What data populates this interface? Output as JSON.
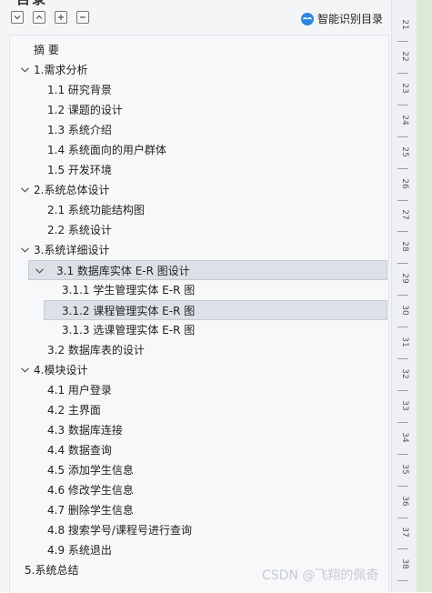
{
  "panel": {
    "title_cut": "目录",
    "smart_label": "智能识别目录",
    "toolbar_buttons": [
      "collapse-all",
      "expand-all",
      "add",
      "remove"
    ]
  },
  "toc": [
    {
      "label": "摘   要",
      "level": 0,
      "expand": "none"
    },
    {
      "label": "1.需求分析",
      "level": 0,
      "expand": "open"
    },
    {
      "label": "1.1  研究背景",
      "level": 1,
      "expand": "none"
    },
    {
      "label": "1.2  课题的设计",
      "level": 1,
      "expand": "none"
    },
    {
      "label": "1.3  系统介绍",
      "level": 1,
      "expand": "none"
    },
    {
      "label": "1.4  系统面向的用户群体",
      "level": 1,
      "expand": "none"
    },
    {
      "label": "1.5  开发环境",
      "level": 1,
      "expand": "none"
    },
    {
      "label": "2.系统总体设计",
      "level": 0,
      "expand": "open"
    },
    {
      "label": "2.1 系统功能结构图",
      "level": 1,
      "expand": "none"
    },
    {
      "label": "2.2 系统设计",
      "level": 1,
      "expand": "none"
    },
    {
      "label": "3.系统详细设计",
      "level": 0,
      "expand": "open"
    },
    {
      "label": "3.1 数据库实体 E-R 图设计",
      "level": 1,
      "expand": "open",
      "selected": true
    },
    {
      "label": "3.1.1 学生管理实体 E-R 图",
      "level": 2,
      "expand": "none"
    },
    {
      "label": "3.1.2 课程管理实体 E-R 图",
      "level": 2,
      "expand": "none",
      "selected": true
    },
    {
      "label": "3.1.3 选课管理实体 E-R 图",
      "level": 2,
      "expand": "none"
    },
    {
      "label": "3.2  数据库表的设计",
      "level": 1,
      "expand": "none"
    },
    {
      "label": "4.模块设计",
      "level": 0,
      "expand": "open"
    },
    {
      "label": "4.1  用户登录",
      "level": 1,
      "expand": "none"
    },
    {
      "label": "4.2  主界面",
      "level": 1,
      "expand": "none"
    },
    {
      "label": "4.3  数据库连接",
      "level": 1,
      "expand": "none"
    },
    {
      "label": "4.4  数据查询",
      "level": 1,
      "expand": "none"
    },
    {
      "label": "4.5  添加学生信息",
      "level": 1,
      "expand": "none"
    },
    {
      "label": "4.6  修改学生信息",
      "level": 1,
      "expand": "none"
    },
    {
      "label": "4.7  删除学生信息",
      "level": 1,
      "expand": "none"
    },
    {
      "label": "4.8  搜索学号/课程号进行查询",
      "level": 1,
      "expand": "none"
    },
    {
      "label": "4.9  系统退出",
      "level": 1,
      "expand": "none"
    },
    {
      "label": "5.系统总结",
      "level": 0,
      "expand": "none"
    }
  ],
  "ruler": [
    "21",
    "22",
    "23",
    "24",
    "25",
    "26",
    "27",
    "28",
    "29",
    "30",
    "31",
    "32",
    "33",
    "34",
    "35",
    "36",
    "37",
    "38"
  ],
  "watermark": "CSDN @飞翔的佩奇",
  "colors": {
    "selected_bg": "#dde1e7",
    "accent": "#2f86e0",
    "strip": "#dbe9d6"
  }
}
